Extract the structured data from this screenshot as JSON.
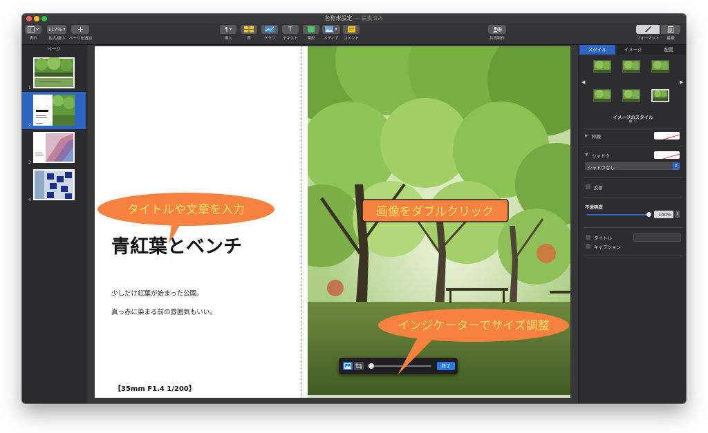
{
  "window": {
    "title": "名称未設定",
    "edited": "— 編集済み"
  },
  "toolbar": {
    "view_label": "表示",
    "zoom_value": "117%",
    "zoom_label": "拡大/縮小",
    "add_page_label": "ページを追加",
    "insert_label": "挿入",
    "table_label": "表",
    "chart_label": "グラフ",
    "text_label": "テキスト",
    "shape_label": "図形",
    "media_label": "メディア",
    "comment_label": "コメント",
    "collaborate_label": "共同制作",
    "format_label": "フォーマット",
    "document_label": "書類"
  },
  "sidebar": {
    "header": "ページ",
    "pages": [
      {
        "number": "1",
        "selected": false
      },
      {
        "number": "2",
        "selected": true
      },
      {
        "number": "3",
        "selected": false
      },
      {
        "number": "4",
        "selected": false
      }
    ]
  },
  "document": {
    "title": "青紅葉とベンチ",
    "line1": "少しだけ紅葉が始まった公園。",
    "line2": "真っ赤に染まる前の雰囲気もいい。",
    "caption": "【35mm  F1.4  1/200】"
  },
  "annotations": {
    "bubble1": "タイトルや文章を入力",
    "bubble2": "画像をダブルクリック",
    "bubble3": "インジケーターでサイズ調整",
    "bubble_color": "#f7813e",
    "text_color": "#ffe36b"
  },
  "mask_bar": {
    "done_label": "終了",
    "slider_value": 0.05
  },
  "right_panel": {
    "tabs": [
      "スタイル",
      "イメージ",
      "配置"
    ],
    "active_tab": "スタイル",
    "image_styles_label": "イメージのスタイル",
    "border_label": "枠線",
    "shadow_label": "シャドウ",
    "shadow_select": "シャドウなし",
    "reflection_label": "反射",
    "opacity_label": "不透明度",
    "opacity_value": "100%",
    "title_label": "タイトル",
    "caption_label": "キャプション",
    "accent_color": "#2c66c2"
  }
}
